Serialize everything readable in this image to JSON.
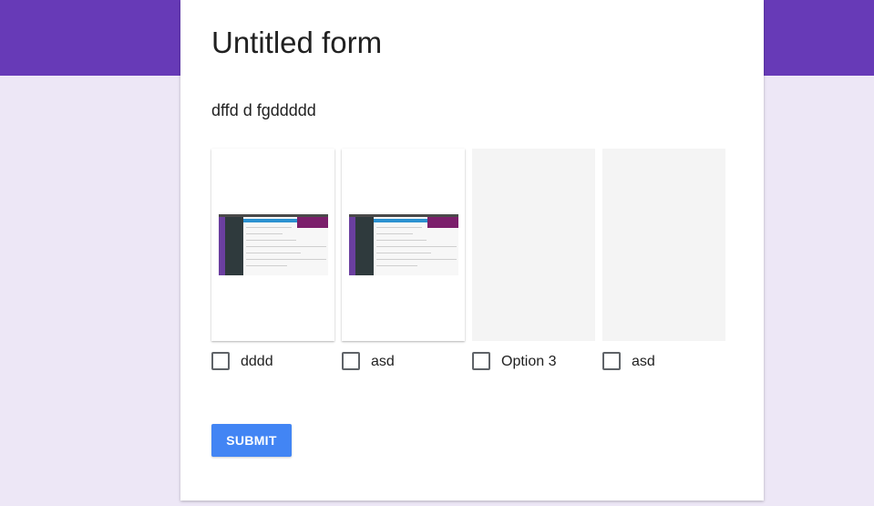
{
  "theme": {
    "banner_color": "#673ab7",
    "background": "#ede7f6",
    "button_color": "#4285f4"
  },
  "form": {
    "title": "Untitled form"
  },
  "question": {
    "title": "dffd d fgddddd",
    "options": [
      {
        "label": "dddd",
        "has_image": true,
        "checked": false
      },
      {
        "label": "asd",
        "has_image": true,
        "checked": false
      },
      {
        "label": "Option 3",
        "has_image": false,
        "checked": false
      },
      {
        "label": "asd",
        "has_image": false,
        "checked": false
      }
    ]
  },
  "actions": {
    "submit_label": "SUBMIT"
  }
}
